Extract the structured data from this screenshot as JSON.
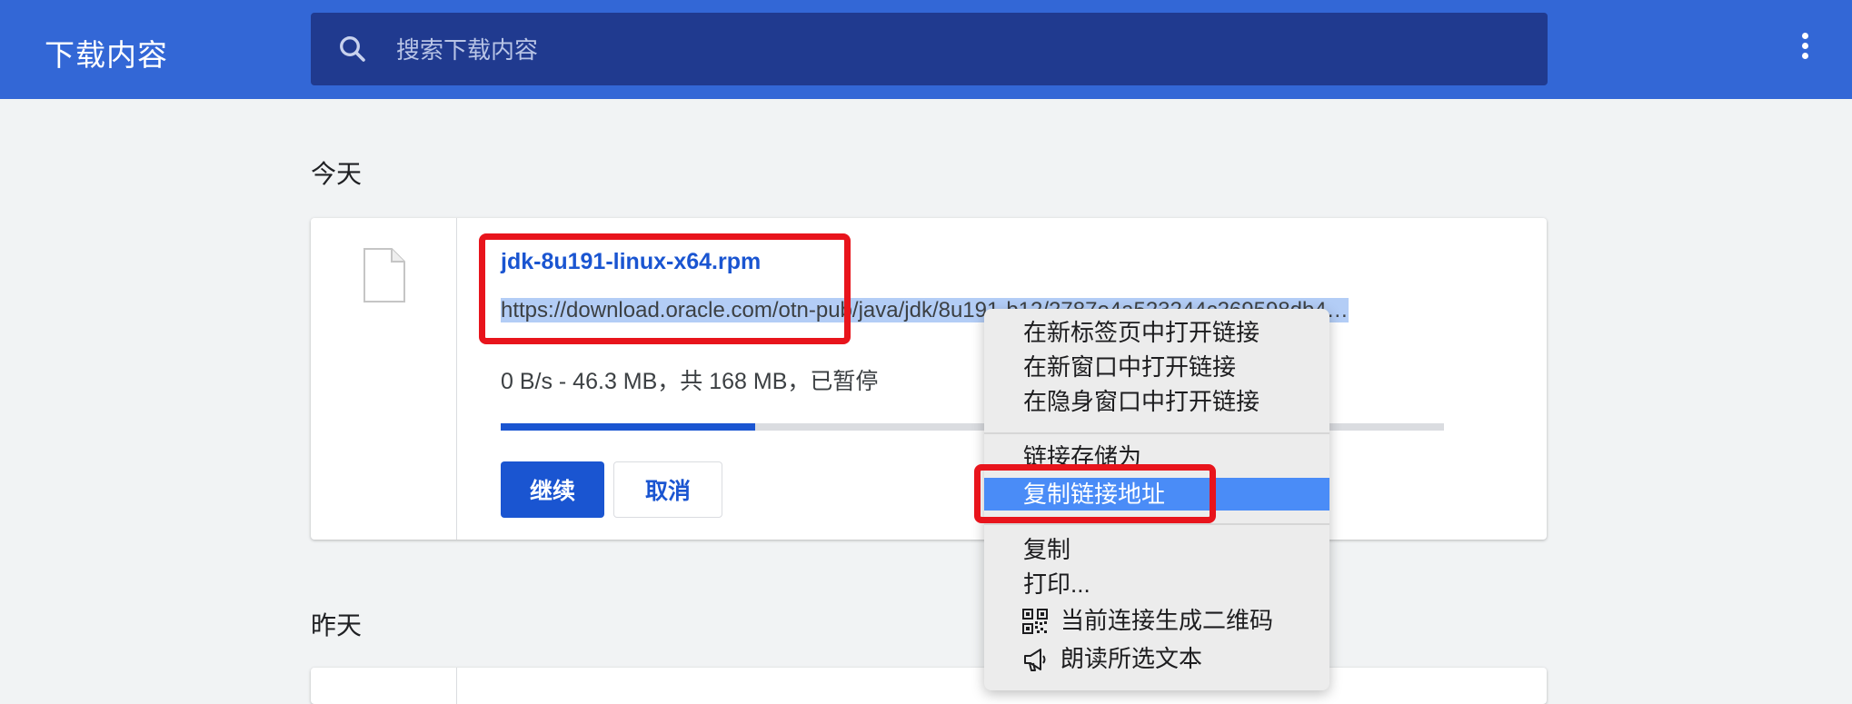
{
  "header": {
    "title": "下载内容",
    "search_placeholder": "搜索下载内容",
    "menu_icon": "more-vert-icon"
  },
  "sections": {
    "today": "今天",
    "yesterday": "昨天"
  },
  "download": {
    "file_name": "jdk-8u191-linux-x64.rpm",
    "url": "https://download.oracle.com/otn-pub/java/jdk/8u191-b12/2787e4a523244c269598db4…",
    "status": "0 B/s - 46.3 MB，共 168 MB，已暂停",
    "progress": 0.27,
    "resume_label": "继续",
    "cancel_label": "取消",
    "file_icon": "document-icon"
  },
  "context_menu": {
    "items": [
      "在新标签页中打开链接",
      "在新窗口中打开链接",
      "在隐身窗口中打开链接",
      "链接存储为",
      "复制链接地址",
      "复制",
      "打印...",
      "当前连接生成二维码",
      "朗读所选文本"
    ],
    "active_index": 4
  },
  "colors": {
    "header_bg": "#3367d6",
    "search_bg": "#203a8f",
    "accent": "#1a55d1",
    "highlight": "#e8141c",
    "menu_active": "#4a8cf7"
  }
}
